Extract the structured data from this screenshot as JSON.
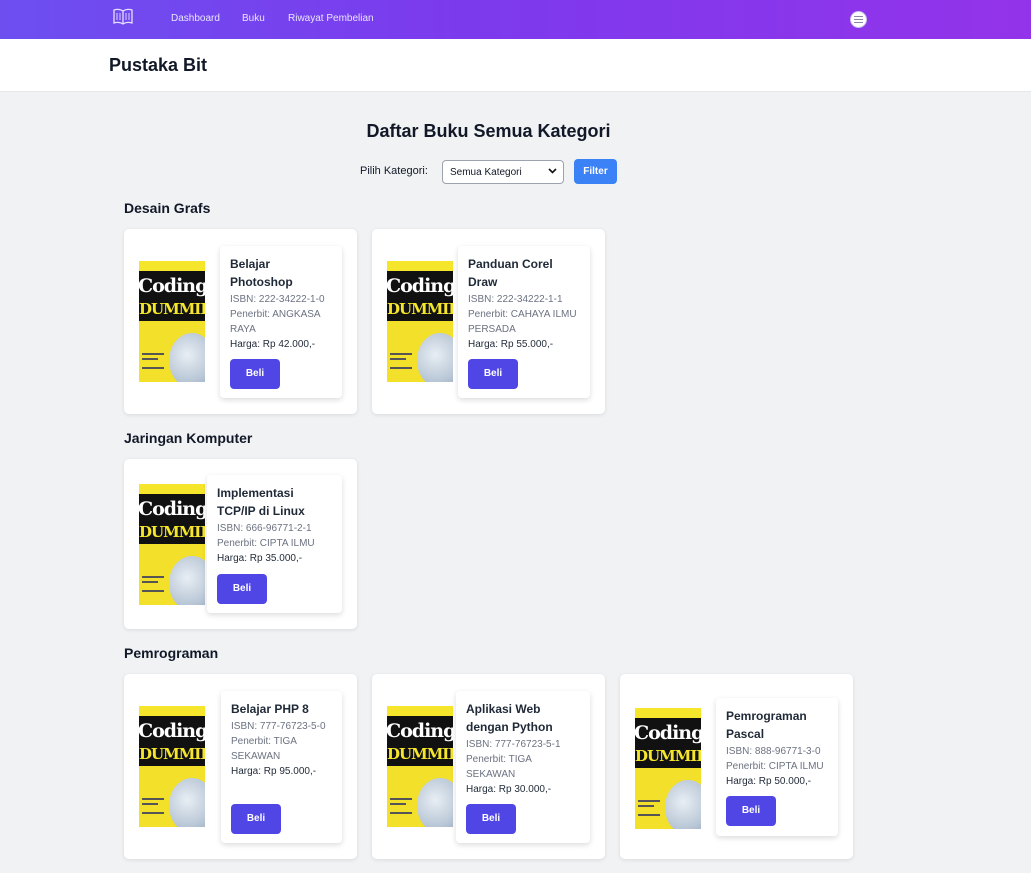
{
  "nav": {
    "links": [
      "Dashboard",
      "Buku",
      "Riwayat Pembelian"
    ]
  },
  "header": {
    "brand": "Pustaka Bit"
  },
  "main": {
    "title": "Daftar Buku Semua Kategori",
    "filter": {
      "label": "Pilih Kategori:",
      "selected": "Semua Kategori",
      "button": "Filter"
    }
  },
  "cover": {
    "title": "Coding",
    "subtitle": "DUMMIES"
  },
  "categories": [
    {
      "name": "Desain Grafs",
      "books": [
        {
          "title": "Belajar Photoshop",
          "isbn": "ISBN: 222-34222-1-0",
          "publisher": "Penerbit: ANGKASA RAYA",
          "price": "Harga: Rp 42.000,-",
          "buy": "Beli"
        },
        {
          "title": "Panduan Corel Draw",
          "isbn": "ISBN: 222-34222-1-1",
          "publisher": "Penerbit: CAHAYA ILMU PERSADA",
          "price": "Harga: Rp 55.000,-",
          "buy": "Beli"
        }
      ]
    },
    {
      "name": "Jaringan Komputer",
      "books": [
        {
          "title": "Implementasi TCP/IP di Linux",
          "isbn": "ISBN: 666-96771-2-1",
          "publisher": "Penerbit: CIPTA ILMU",
          "price": "Harga: Rp 35.000,-",
          "buy": "Beli"
        }
      ]
    },
    {
      "name": "Pemrograman",
      "books": [
        {
          "title": "Belajar PHP 8",
          "isbn": "ISBN: 777-76723-5-0",
          "publisher": "Penerbit: TIGA SEKAWAN",
          "price": "Harga: Rp 95.000,-",
          "buy": "Beli"
        },
        {
          "title": "Aplikasi Web dengan Python",
          "isbn": "ISBN: 777-76723-5-1",
          "publisher": "Penerbit: TIGA SEKAWAN",
          "price": "Harga: Rp 30.000,-",
          "buy": "Beli"
        },
        {
          "title": "Pemrograman Pascal",
          "isbn": "ISBN: 888-96771-3-0",
          "publisher": "Penerbit: CIPTA ILMU",
          "price": "Harga: Rp 50.000,-",
          "buy": "Beli"
        }
      ]
    }
  ]
}
